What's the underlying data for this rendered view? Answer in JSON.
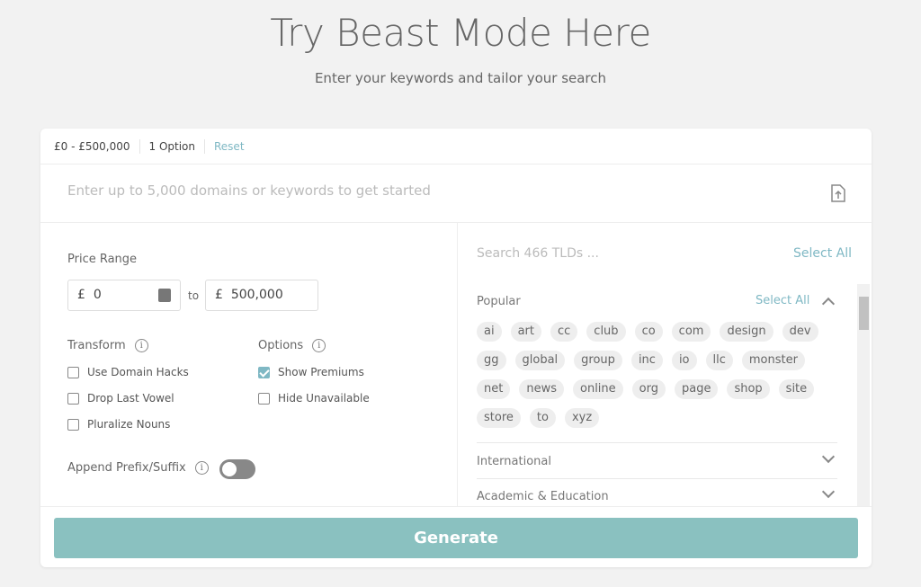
{
  "header": {
    "title": "Try Beast Mode Here",
    "subtitle": "Enter your keywords and tailor your search"
  },
  "summary": {
    "price": "£0 - £500,000",
    "options": "1 Option",
    "reset": "Reset"
  },
  "keywords": {
    "placeholder": "Enter up to 5,000 domains or keywords to get started"
  },
  "price": {
    "label": "Price Range",
    "currency": "£",
    "min": "0",
    "to": "to",
    "max": "500,000"
  },
  "transform": {
    "label": "Transform",
    "items": [
      {
        "label": "Use Domain Hacks",
        "checked": false
      },
      {
        "label": "Drop Last Vowel",
        "checked": false
      },
      {
        "label": "Pluralize Nouns",
        "checked": false
      }
    ]
  },
  "options": {
    "label": "Options",
    "items": [
      {
        "label": "Show Premiums",
        "checked": true
      },
      {
        "label": "Hide Unavailable",
        "checked": false
      }
    ]
  },
  "append": {
    "label": "Append Prefix/Suffix",
    "enabled": false
  },
  "tlds": {
    "search_placeholder": "Search 466 TLDs ...",
    "select_all": "Select All",
    "popular": {
      "title": "Popular",
      "select_all": "Select All",
      "chips": [
        "ai",
        "art",
        "cc",
        "club",
        "co",
        "com",
        "design",
        "dev",
        "gg",
        "global",
        "group",
        "inc",
        "io",
        "llc",
        "monster",
        "net",
        "news",
        "online",
        "org",
        "page",
        "shop",
        "site",
        "store",
        "to",
        "xyz"
      ]
    },
    "sections": [
      "International",
      "Academic & Education"
    ]
  },
  "generate": "Generate",
  "colors": {
    "accent": "#7fb8c4",
    "button": "#8ac1c0"
  }
}
